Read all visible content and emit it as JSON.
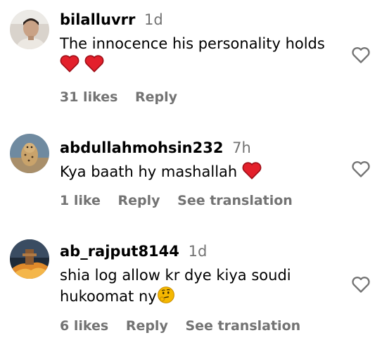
{
  "comments": [
    {
      "username": "bilalluvrr",
      "time": "1d",
      "text": "The innocence his personality holds",
      "emoji": [
        "red-heart",
        "red-heart"
      ],
      "likes": "31 likes",
      "reply": "Reply",
      "translation": ""
    },
    {
      "username": "abdullahmohsin232",
      "time": "7h",
      "text": "Kya baath hy mashallah",
      "emoji": [
        "red-heart"
      ],
      "likes": "1 like",
      "reply": "Reply",
      "translation": "See translation"
    },
    {
      "username": "ab_rajput8144",
      "time": "1d",
      "text_line1": "shia log allow kr dye kiya soudi",
      "text_line2": "hukoomat ny",
      "emoji": [
        "thinking-face"
      ],
      "likes": "6 likes",
      "reply": "Reply",
      "translation": "See translation"
    }
  ],
  "icons": {
    "like": "heart-outline-icon",
    "heart": "red-heart-emoji",
    "thinking": "thinking-face-emoji"
  },
  "colors": {
    "secondary_text": "#737373",
    "heart_red": "#e3202b",
    "emoji_yellow": "#f5b800"
  }
}
